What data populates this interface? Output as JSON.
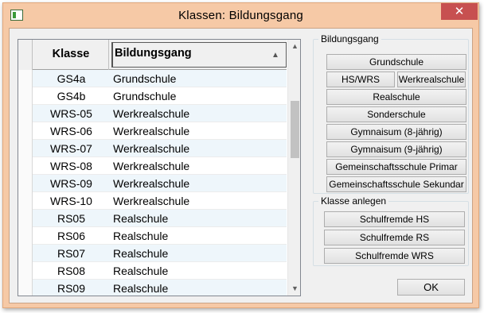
{
  "window": {
    "title": "Klassen: Bildungsgang",
    "close_glyph": "✕"
  },
  "grid": {
    "columns": [
      "Klasse",
      "Bildungsgang"
    ],
    "sort_glyph": "▲",
    "rows": [
      [
        "GS4a",
        "Grundschule"
      ],
      [
        "GS4b",
        "Grundschule"
      ],
      [
        "WRS-05",
        "Werkrealschule"
      ],
      [
        "WRS-06",
        "Werkrealschule"
      ],
      [
        "WRS-07",
        "Werkrealschule"
      ],
      [
        "WRS-08",
        "Werkrealschule"
      ],
      [
        "WRS-09",
        "Werkrealschule"
      ],
      [
        "WRS-10",
        "Werkrealschule"
      ],
      [
        "RS05",
        "Realschule"
      ],
      [
        "RS06",
        "Realschule"
      ],
      [
        "RS07",
        "Realschule"
      ],
      [
        "RS08",
        "Realschule"
      ],
      [
        "RS09",
        "Realschule"
      ]
    ],
    "scroll_up_glyph": "▲",
    "scroll_down_glyph": "▼"
  },
  "bildungsgang": {
    "title": "Bildungsgang",
    "buttons": {
      "grundschule": "Grundschule",
      "hswrs": "HS/WRS",
      "werkrealschule": "Werkrealschule",
      "realschule": "Realschule",
      "sonderschule": "Sonderschule",
      "gymnasium8": "Gymnaisum (8-jährig)",
      "gymnasium9": "Gymnaisum (9-jährig)",
      "gms_primar": "Gemeinschaftsschule Primar",
      "gms_sekundar": "Gemeinschaftsschule Sekundar"
    }
  },
  "klasse_anlegen": {
    "title": "Klasse anlegen",
    "buttons": {
      "hs": "Schulfremde HS",
      "rs": "Schulfremde RS",
      "wrs": "Schulfremde WRS"
    }
  },
  "footer": {
    "ok_label": "OK"
  }
}
